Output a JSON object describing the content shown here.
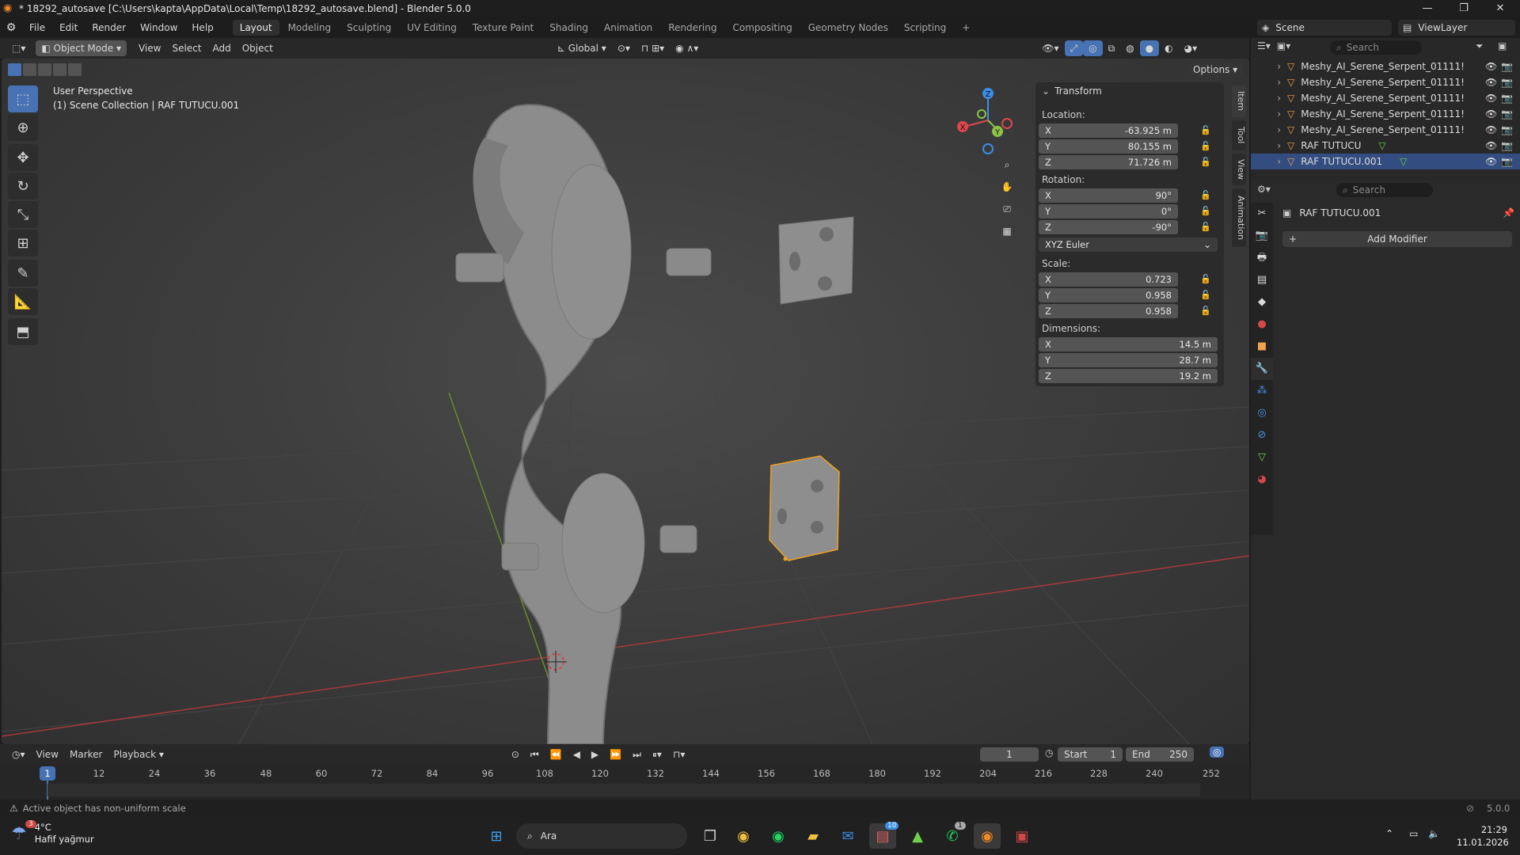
{
  "title_bar": {
    "title": "* 18292_autosave [C:\\Users\\kapta\\AppData\\Local\\Temp\\18292_autosave.blend] - Blender 5.0.0",
    "minimize": "—",
    "maximize": "❐",
    "close": "✕"
  },
  "menu": [
    "File",
    "Edit",
    "Render",
    "Window",
    "Help"
  ],
  "workspaces": [
    "Layout",
    "Modeling",
    "Sculpting",
    "UV Editing",
    "Texture Paint",
    "Shading",
    "Animation",
    "Rendering",
    "Compositing",
    "Geometry Nodes",
    "Scripting"
  ],
  "workspace_add": "+",
  "scene": {
    "label": "Scene",
    "view_layer": "ViewLayer"
  },
  "viewport_header": {
    "mode": "Object Mode",
    "menus": [
      "View",
      "Select",
      "Add",
      "Object"
    ],
    "orientation": "Global",
    "options": "Options"
  },
  "viewport": {
    "perspective": "User Perspective",
    "collection": "(1) Scene Collection | RAF TUTUCU.001",
    "gizmo_axes": {
      "x": "X",
      "y": "Y",
      "z": "Z"
    }
  },
  "tools": [
    "select-box-icon",
    "cursor-icon",
    "move-icon",
    "rotate-icon",
    "scale-icon",
    "transform-icon",
    "annotate-icon",
    "measure-icon",
    "add-cube-icon"
  ],
  "npanel": {
    "header": "Transform",
    "location_label": "Location:",
    "location": [
      {
        "axis": "X",
        "value": "-63.925 m"
      },
      {
        "axis": "Y",
        "value": "80.155 m"
      },
      {
        "axis": "Z",
        "value": "71.726 m"
      }
    ],
    "rotation_label": "Rotation:",
    "rotation": [
      {
        "axis": "X",
        "value": "90°"
      },
      {
        "axis": "Y",
        "value": "0°"
      },
      {
        "axis": "Z",
        "value": "-90°"
      }
    ],
    "rotation_mode": "XYZ Euler",
    "scale_label": "Scale:",
    "scale": [
      {
        "axis": "X",
        "value": "0.723"
      },
      {
        "axis": "Y",
        "value": "0.958"
      },
      {
        "axis": "Z",
        "value": "0.958"
      }
    ],
    "dimensions_label": "Dimensions:",
    "dimensions": [
      {
        "axis": "X",
        "value": "14.5 m"
      },
      {
        "axis": "Y",
        "value": "28.7 m"
      },
      {
        "axis": "Z",
        "value": "19.2 m"
      }
    ],
    "tabs": [
      "Item",
      "Tool",
      "View",
      "Animation"
    ]
  },
  "outliner": {
    "search_placeholder": "Search",
    "items": [
      {
        "name": "Meshy_AI_Serene_Serpent_01111!",
        "has_modifier": false
      },
      {
        "name": "Meshy_AI_Serene_Serpent_01111!",
        "has_modifier": false
      },
      {
        "name": "Meshy_AI_Serene_Serpent_01111!",
        "has_modifier": false
      },
      {
        "name": "Meshy_AI_Serene_Serpent_01111!",
        "has_modifier": false
      },
      {
        "name": "Meshy_AI_Serene_Serpent_01111!",
        "has_modifier": false
      },
      {
        "name": "RAF TUTUCU",
        "has_modifier": true
      },
      {
        "name": "RAF TUTUCU.001",
        "has_modifier": true
      }
    ]
  },
  "properties": {
    "search_placeholder": "Search",
    "object_name": "RAF TUTUCU.001",
    "add_modifier": "Add Modifier"
  },
  "timeline": {
    "menus": [
      "View",
      "Marker",
      "Playback"
    ],
    "current_frame": "1",
    "start_label": "Start",
    "start": "1",
    "end_label": "End",
    "end": "250",
    "ticks": [
      "1",
      "12",
      "24",
      "36",
      "48",
      "60",
      "72",
      "84",
      "96",
      "108",
      "120",
      "132",
      "144",
      "156",
      "168",
      "180",
      "192",
      "204",
      "216",
      "228",
      "240",
      "252"
    ]
  },
  "status": {
    "message": "Active object has non-uniform scale",
    "version": "5.0.0"
  },
  "taskbar": {
    "weather_temp": "4°C",
    "weather_desc": "Hafif yağmur",
    "weather_badge": "3",
    "search": "Ara",
    "time": "21:29",
    "date": "11.01.2026",
    "mail_badge": "10",
    "whatsapp_badge": "1"
  },
  "colors": {
    "accent": "#4772b3",
    "axis_x": "#e0474c",
    "axis_y": "#8bc34a",
    "axis_z": "#3b8ee6"
  }
}
